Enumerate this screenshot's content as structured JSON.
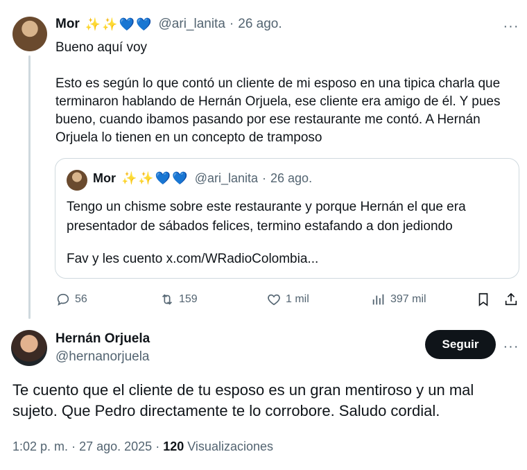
{
  "tweet1": {
    "name": "Mor",
    "emojis": [
      "✨",
      "✨",
      "💙",
      "💙"
    ],
    "handle": "@ari_lanita",
    "date": "26 ago.",
    "line1": "Bueno aquí voy",
    "paragraph": "Esto es según lo que contó un cliente de mi esposo en una tipica charla que terminaron hablando de Hernán Orjuela, ese cliente era amigo de él. Y pues bueno, cuando ibamos pasando por ese restaurante me contó. A Hernán Orjuela lo tienen en un concepto de tramposo",
    "more": "···"
  },
  "quote": {
    "name": "Mor",
    "handle": "@ari_lanita",
    "date": "26 ago.",
    "text1": "Tengo un chisme sobre este restaurante y porque Hernán el que era presentador de sábados felices, termino estafando a don jediondo",
    "text2": "Fav y les cuento x.com/WRadioColombia..."
  },
  "actions": {
    "replies": "56",
    "retweets": "159",
    "likes": "1 mil",
    "views": "397 mil"
  },
  "tweet2": {
    "name": "Hernán Orjuela",
    "handle": "@hernanorjuela",
    "follow_label": "Seguir",
    "more": "···",
    "text": "Te cuento que el cliente de tu esposo es un gran mentiroso y un mal sujeto. Que Pedro directamente te lo corrobore. Saludo cordial.",
    "time": "1:02 p. m.",
    "date": "27 ago. 2025",
    "views_count": "120",
    "views_label": "Visualizaciones"
  },
  "colors": {
    "text": "#0f1419",
    "secondary": "#536471",
    "border": "#cfd9de",
    "button_bg": "#0f1419"
  },
  "icons": [
    "reply-icon",
    "retweet-icon",
    "like-icon",
    "views-icon",
    "bookmark-icon",
    "share-icon",
    "more-icon"
  ]
}
